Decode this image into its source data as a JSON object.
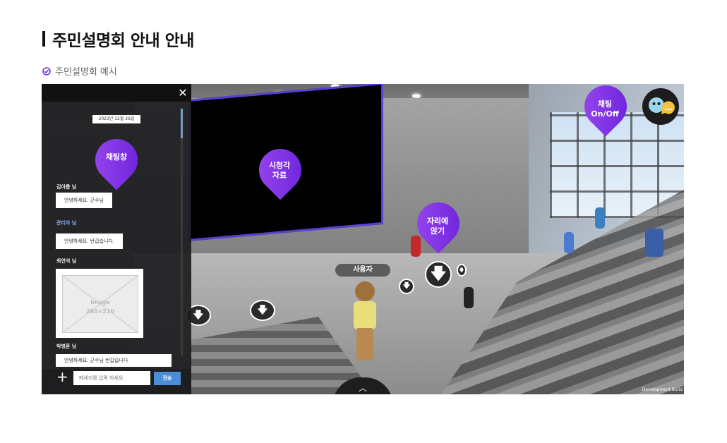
{
  "page": {
    "title": "주민설명회 안내 안내",
    "subtitle": "주민설명회 예시"
  },
  "chat": {
    "date": "2023년 12월 26일",
    "messages": [
      {
        "sender": "김아름 님",
        "text": "안녕하세요. 군수님"
      },
      {
        "sender": "관리자 님",
        "text": "안녕하세요. 반갑습니다."
      },
      {
        "sender": "최연석 님",
        "image_label": "Image",
        "image_size": "280×210"
      },
      {
        "sender": "박병훈 님",
        "text": "안녕하세요. 군수님 반갑습니다"
      }
    ],
    "input_placeholder": "메세지를 입력 하세요.",
    "send_label": "전송"
  },
  "callouts": {
    "chat_window": "채팅창",
    "av_material_line1": "시청각",
    "av_material_line2": "자료",
    "sit_line1": "자리에",
    "sit_line2": "앉기",
    "chat_toggle_line1": "채팅",
    "chat_toggle_line2": "On/Off"
  },
  "scene": {
    "user_label": "사용자",
    "build_label": "Development Build"
  },
  "colors": {
    "accent_purple": "#7b2ff0",
    "send_blue": "#4a8ed8",
    "admin_blue": "#7db4ff"
  }
}
